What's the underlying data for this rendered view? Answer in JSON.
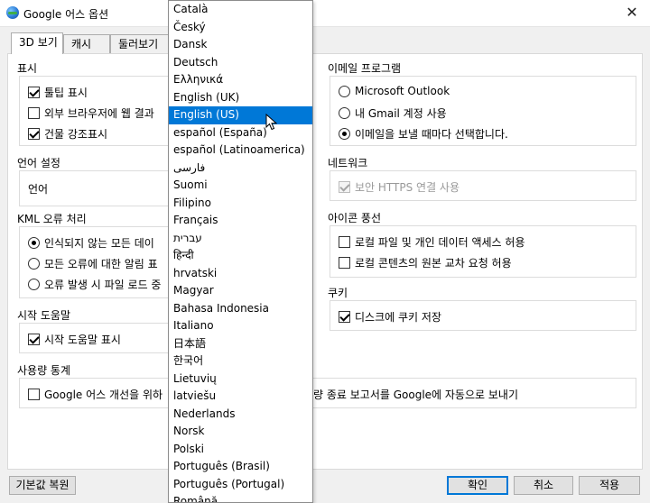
{
  "window": {
    "title": "Google 어스 옵션",
    "close_glyph": "✕"
  },
  "tabs": [
    {
      "label": "3D 보기",
      "active": true
    },
    {
      "label": "캐시",
      "active": false
    },
    {
      "label": "둘러보기",
      "active": false
    }
  ],
  "display": {
    "title": "표시",
    "items": [
      {
        "label": "툴팁 표시",
        "checked": true
      },
      {
        "label": "외부 브라우저에 웹 결과",
        "checked": false
      },
      {
        "label": "건물 강조표시",
        "checked": true
      }
    ]
  },
  "language": {
    "title": "언어 설정",
    "label": "언어"
  },
  "kml": {
    "title": "KML 오류 처리",
    "items": [
      {
        "label": "인식되지 않는 모든 데이",
        "checked": true
      },
      {
        "label": "모든 오류에 대한 알림 표",
        "checked": false
      },
      {
        "label": "오류 발생 시 파일 로드 중",
        "checked": false
      }
    ]
  },
  "startup": {
    "title": "시작 도움말",
    "item": {
      "label": "시작 도움말 표시",
      "checked": true
    }
  },
  "usage": {
    "title": "사용량 통계",
    "item": {
      "label": "Google 어스 개선을 위하",
      "checked": false
    },
    "item_rest": "량 종료 보고서를 Google에 자동으로 보내기"
  },
  "email": {
    "title": "이메일 프로그램",
    "items": [
      {
        "label": "Microsoft Outlook",
        "checked": false
      },
      {
        "label": "내 Gmail 계정 사용",
        "checked": false
      },
      {
        "label": "이메일을 보낼 때마다 선택합니다.",
        "checked": true
      }
    ]
  },
  "network": {
    "title": "네트워크",
    "item": {
      "label": "보안 HTTPS 연결 사용",
      "checked": true,
      "disabled": true
    }
  },
  "balloon": {
    "title": "아이콘 풍선",
    "items": [
      {
        "label": "로컬 파일 및 개인 데이터 액세스 허용",
        "checked": false
      },
      {
        "label": "로컬 콘텐츠의 원본 교차 요청 허용",
        "checked": false
      }
    ]
  },
  "cookies": {
    "title": "쿠키",
    "item": {
      "label": "디스크에 쿠키 저장",
      "checked": true
    }
  },
  "buttons": {
    "restore": "기본값 복원",
    "ok": "확인",
    "cancel": "취소",
    "apply": "적용"
  },
  "languages": [
    "Català",
    "Český",
    "Dansk",
    "Deutsch",
    "Ελληνικά",
    "English (UK)",
    "English (US)",
    "español (España)",
    "español (Latinoamerica)",
    "فارسی",
    "Suomi",
    "Filipino",
    "Français",
    "עברית",
    "हिन्दी",
    "hrvatski",
    "Magyar",
    "Bahasa Indonesia",
    "Italiano",
    "日本語",
    "한국어",
    "Lietuvių",
    "latviešu",
    "Nederlands",
    "Norsk",
    "Polski",
    "Português (Brasil)",
    "Português (Portugal)",
    "Română"
  ],
  "selected_language": "English (US)"
}
